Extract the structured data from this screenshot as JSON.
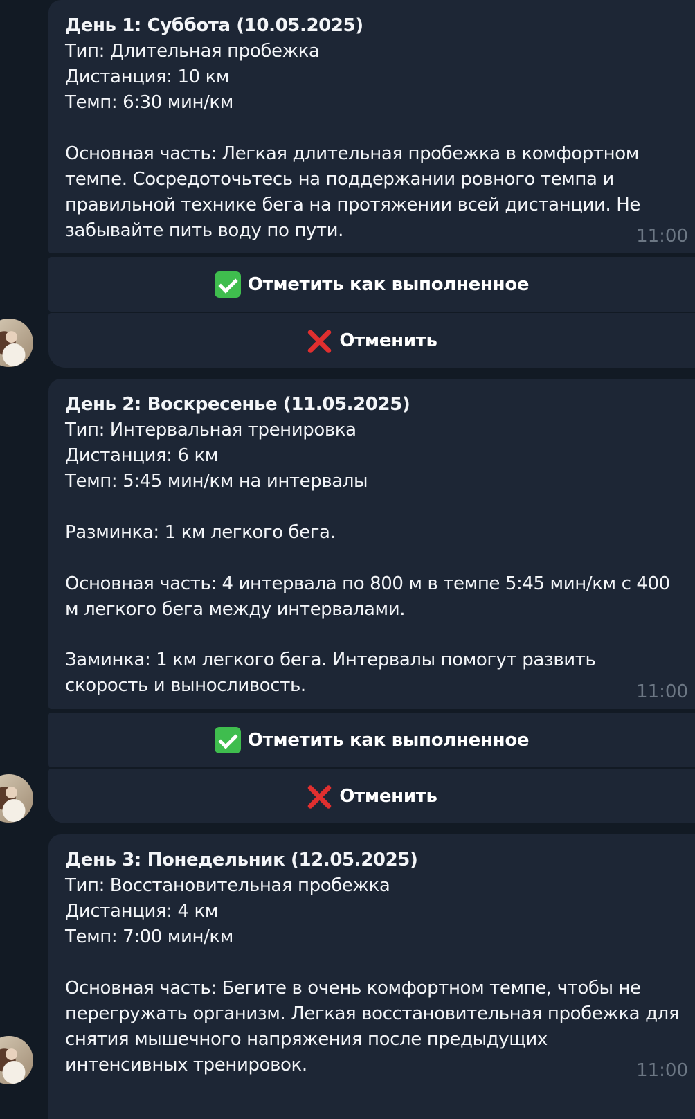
{
  "messages": [
    {
      "title": "День 1: Суббота (10.05.2025)",
      "type": "Тип: Длительная пробежка",
      "distance": "Дистанция: 10 км",
      "pace": "Темп: 6:30 мин/км",
      "body_lines": [
        "Основная часть: Легкая длительная пробежка в комфортном",
        "темпе. Сосредоточьтесь на поддержании ровного темпа и",
        "правильной технике бега на протяжении всей дистанции. Не",
        "забывайте пить воду по пути."
      ],
      "time": "11:00",
      "done_label": "Отметить как выполненное",
      "cancel_label": "Отменить"
    },
    {
      "title": "День 2: Воскресенье (11.05.2025)",
      "type": "Тип: Интервальная тренировка",
      "distance": "Дистанция: 6 км",
      "pace": "Темп: 5:45 мин/км на интервалы",
      "warmup": "Разминка: 1 км легкого бега.",
      "main_lines": [
        "Основная часть: 4 интервала по 800 м в темпе 5:45 мин/км с 400",
        "м легкого бега между интервалами."
      ],
      "cooldown_lines": [
        "Заминка: 1 км легкого бега. Интервалы помогут развить",
        "скорость и выносливость."
      ],
      "time": "11:00",
      "done_label": "Отметить как выполненное",
      "cancel_label": "Отменить"
    },
    {
      "title": "День 3: Понедельник (12.05.2025)",
      "type": "Тип: Восстановительная пробежка",
      "distance": "Дистанция: 4 км",
      "pace": "Темп: 7:00 мин/км",
      "body_lines": [
        "Основная часть: Бегите в очень комфортном темпе, чтобы не",
        "перегружать организм. Легкая восстановительная пробежка для",
        "снятия мышечного напряжения после предыдущих",
        "интенсивных тренировок."
      ],
      "time": "11:00"
    }
  ],
  "icons": {
    "done": "check-mark-icon",
    "cancel": "cross-mark-icon",
    "done_color": "#3fbd4e",
    "cancel_color": "#e02f2f"
  },
  "colors": {
    "background": "#121a24",
    "bubble": "#1d2635",
    "text": "#f3f5f8",
    "time": "#6c7784"
  }
}
